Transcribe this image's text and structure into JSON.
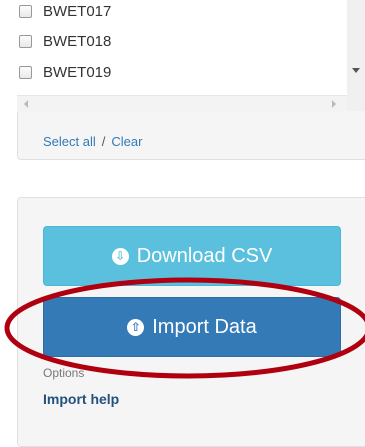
{
  "site_list": {
    "items": [
      {
        "label": "BWET017"
      },
      {
        "label": "BWET018"
      },
      {
        "label": "BWET019"
      }
    ]
  },
  "selection": {
    "select_all": "Select all",
    "separator": "/",
    "clear": "Clear"
  },
  "actions": {
    "download_label": "Download CSV",
    "import_label": "Import Data"
  },
  "options_label": "Options",
  "import_help_label": "Import help",
  "colors": {
    "download": "#5bc0de",
    "import": "#337ab7",
    "highlight": "#b00010"
  }
}
